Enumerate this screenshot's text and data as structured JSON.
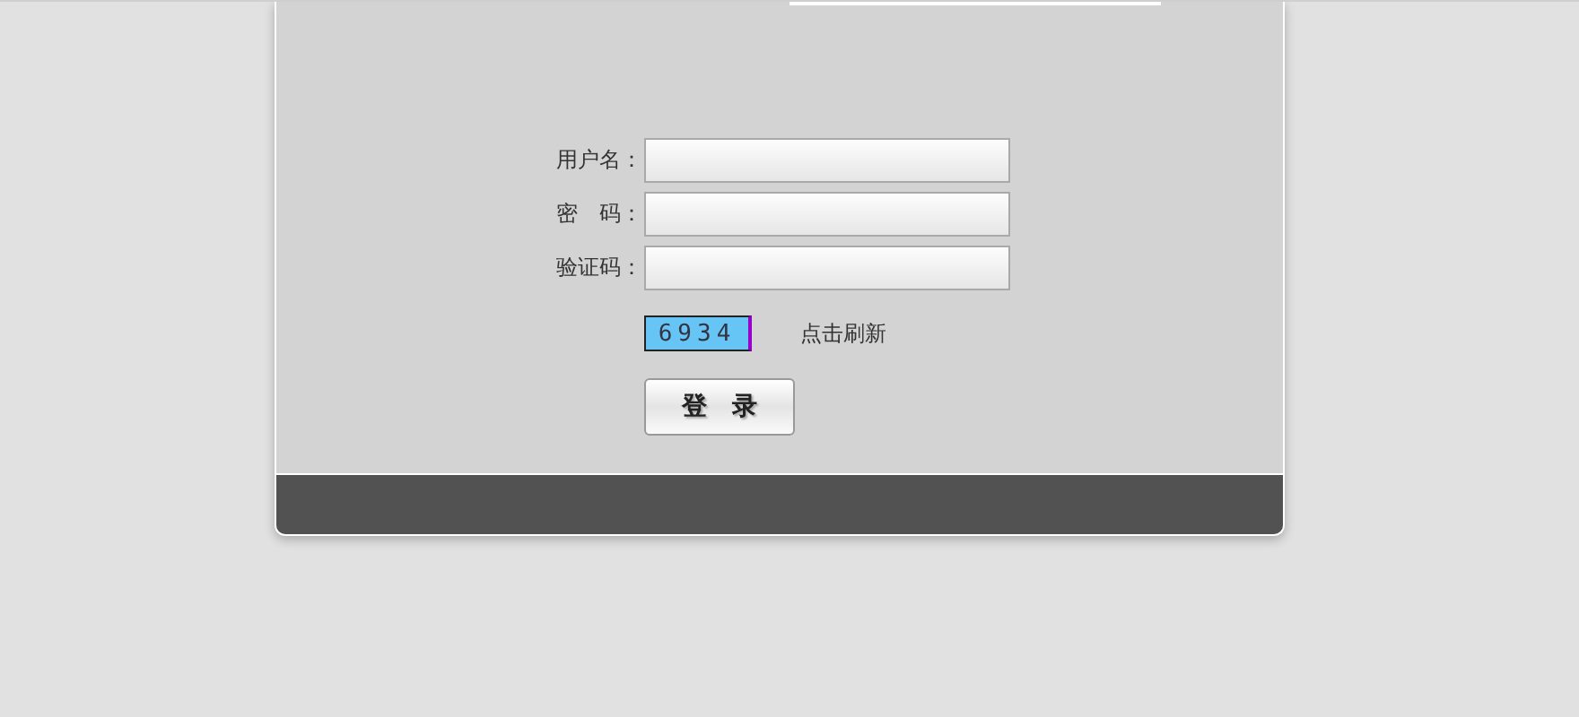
{
  "fields": [
    {
      "label": "用户名："
    },
    {
      "label": "密　码："
    },
    {
      "label": "验证码："
    }
  ],
  "captcha": {
    "code": "6934",
    "refresh": "点击刷新"
  },
  "login_button": "登　录"
}
